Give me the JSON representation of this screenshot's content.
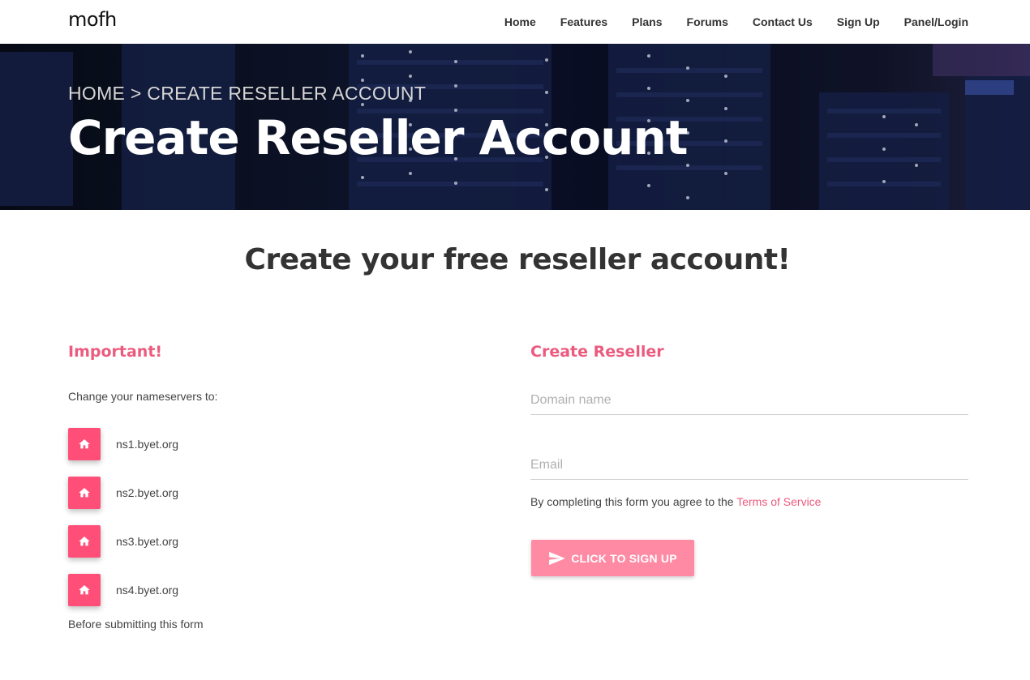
{
  "brand": {
    "logo": "mofh"
  },
  "nav": {
    "items": [
      {
        "label": "Home"
      },
      {
        "label": "Features"
      },
      {
        "label": "Plans"
      },
      {
        "label": "Forums"
      },
      {
        "label": "Contact Us"
      },
      {
        "label": "Sign Up"
      },
      {
        "label": "Panel/Login"
      }
    ]
  },
  "hero": {
    "breadcrumb": "HOME > CREATE RESELLER ACCOUNT",
    "title": "Create Reseller Account"
  },
  "main": {
    "heading": "Create your free reseller account!"
  },
  "important": {
    "title": "Important!",
    "intro": "Change your nameservers to:",
    "nameservers": [
      {
        "host": "ns1.byet.org",
        "icon": "home-icon"
      },
      {
        "host": "ns2.byet.org",
        "icon": "home-icon"
      },
      {
        "host": "ns3.byet.org",
        "icon": "home-icon"
      },
      {
        "host": "ns4.byet.org",
        "icon": "home-icon"
      }
    ],
    "outro": "Before submitting this form"
  },
  "form": {
    "title": "Create Reseller",
    "domain_placeholder": "Domain name",
    "domain_value": "",
    "email_placeholder": "Email",
    "email_value": "",
    "agree_text": "By completing this form you agree to the ",
    "terms_link": "Terms of Service",
    "submit_label": "CLICK TO SIGN UP",
    "submit_icon": "paper-plane-icon"
  },
  "colors": {
    "accent": "#ec5b7e",
    "badge": "#ff4f79",
    "button": "#ff8aa4"
  }
}
